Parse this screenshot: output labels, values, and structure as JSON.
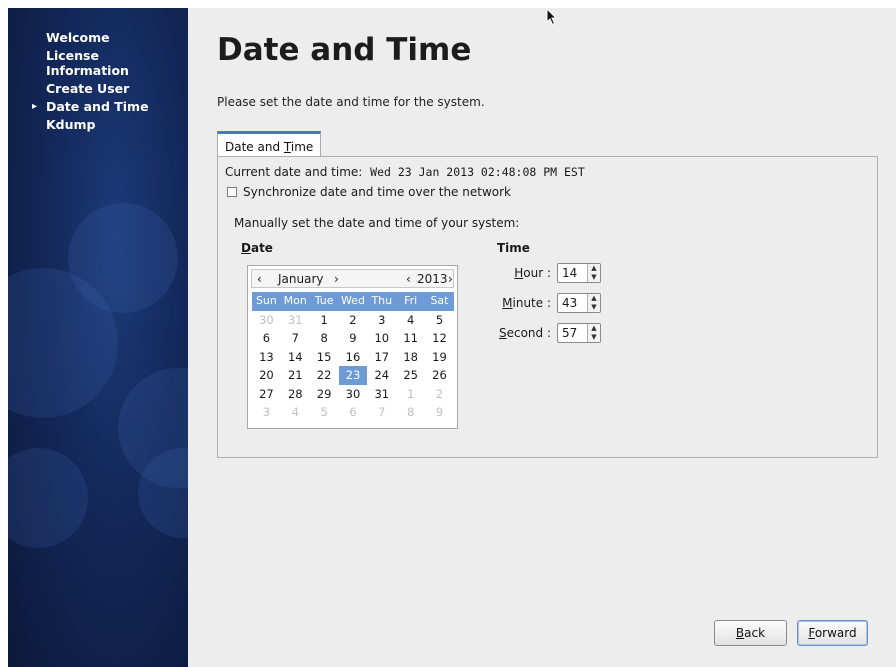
{
  "sidebar": {
    "items": [
      {
        "label": "Welcome",
        "active": false
      },
      {
        "label": "License Information",
        "active": false
      },
      {
        "label": "Create User",
        "active": false
      },
      {
        "label": "Date and Time",
        "active": true
      },
      {
        "label": "Kdump",
        "active": false
      }
    ],
    "background_color": "#13285a"
  },
  "main": {
    "title": "Date and Time",
    "subtitle": "Please set the date and time for the system.",
    "tab_label_prefix": "Date and ",
    "tab_label_mnemonic": "T",
    "tab_label_suffix": "ime",
    "current_label": "Current date and time:",
    "current_value": "Wed 23 Jan 2013 02:48:08 PM EST",
    "sync_label": "Synchronize date and time over the network",
    "sync_checked": false,
    "manual_label": "Manually set the date and time of your system:",
    "date_heading_mnemonic": "D",
    "date_heading_rest": "ate",
    "time_heading": "Time"
  },
  "calendar": {
    "month": "January",
    "year": "2013",
    "prev_month": "‹",
    "next_month": "›",
    "prev_year": "‹",
    "next_year": "›",
    "weekdays": [
      "Sun",
      "Mon",
      "Tue",
      "Wed",
      "Thu",
      "Fri",
      "Sat"
    ],
    "weeks": [
      [
        "30",
        "31",
        "1",
        "2",
        "3",
        "4",
        "5"
      ],
      [
        "6",
        "7",
        "8",
        "9",
        "10",
        "11",
        "12"
      ],
      [
        "13",
        "14",
        "15",
        "16",
        "17",
        "18",
        "19"
      ],
      [
        "20",
        "21",
        "22",
        "23",
        "24",
        "25",
        "26"
      ],
      [
        "27",
        "28",
        "29",
        "30",
        "31",
        "1",
        "2"
      ],
      [
        "3",
        "4",
        "5",
        "6",
        "7",
        "8",
        "9"
      ]
    ],
    "selected_day": "23",
    "selection_color": "#6e9bd5"
  },
  "time": {
    "hour_mnemonic": "H",
    "hour_rest": "our :",
    "hour_value": "14",
    "minute_mnemonic": "M",
    "minute_rest": "inute :",
    "minute_value": "43",
    "second_mnemonic": "S",
    "second_rest": "econd :",
    "second_value": "57"
  },
  "buttons": {
    "back_mnemonic": "B",
    "back_rest": "ack",
    "forward_mnemonic": "F",
    "forward_rest": "orward"
  },
  "colors": {
    "tab_accent": "#4a78c8",
    "panel_bg": "#ededed"
  }
}
